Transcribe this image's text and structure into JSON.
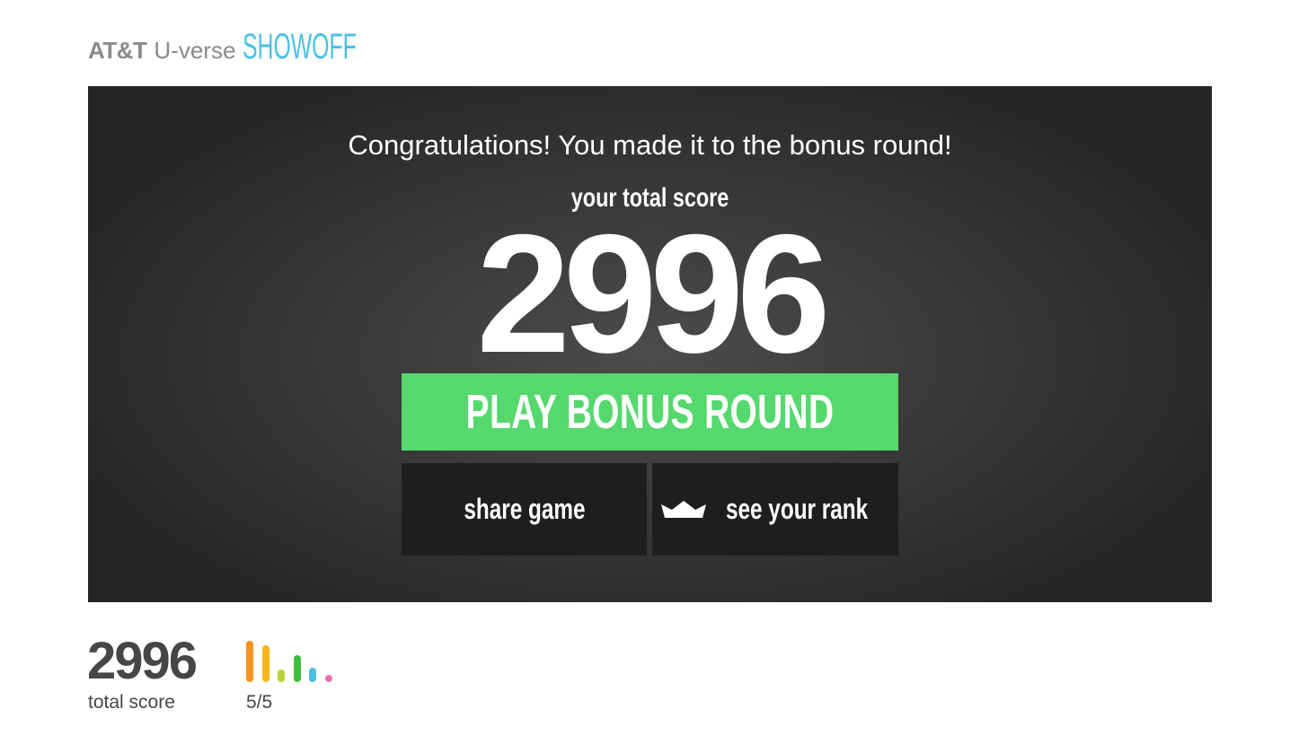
{
  "header": {
    "brand_att": "AT&T",
    "brand_uverse": "U-verse",
    "brand_showoff": "SHOWOFF",
    "showoff_color": "#49c0e6"
  },
  "stage": {
    "congrats": "Congratulations! You made it to the bonus round!",
    "score_label": "your total score",
    "score": "2996",
    "play_button_label": "PLAY BONUS ROUND",
    "play_button_color": "#55d86d",
    "share_button_label": "share game",
    "rank_button_label": "see your rank",
    "rank_icon": "crown-icon"
  },
  "footer": {
    "score": "2996",
    "score_label": "total score",
    "progress_label": "5/5",
    "progress": {
      "completed": 5,
      "total": 5,
      "bars": [
        {
          "color": "#f7941d",
          "level": 1.0
        },
        {
          "color": "#f7b51d",
          "level": 0.9
        },
        {
          "color": "#b5d334",
          "level": 0.3
        },
        {
          "color": "#3cc13c",
          "level": 0.65
        },
        {
          "color": "#49c0e6",
          "level": 0.35
        },
        {
          "color": "#f06fb0",
          "level": 0.12
        }
      ]
    }
  }
}
